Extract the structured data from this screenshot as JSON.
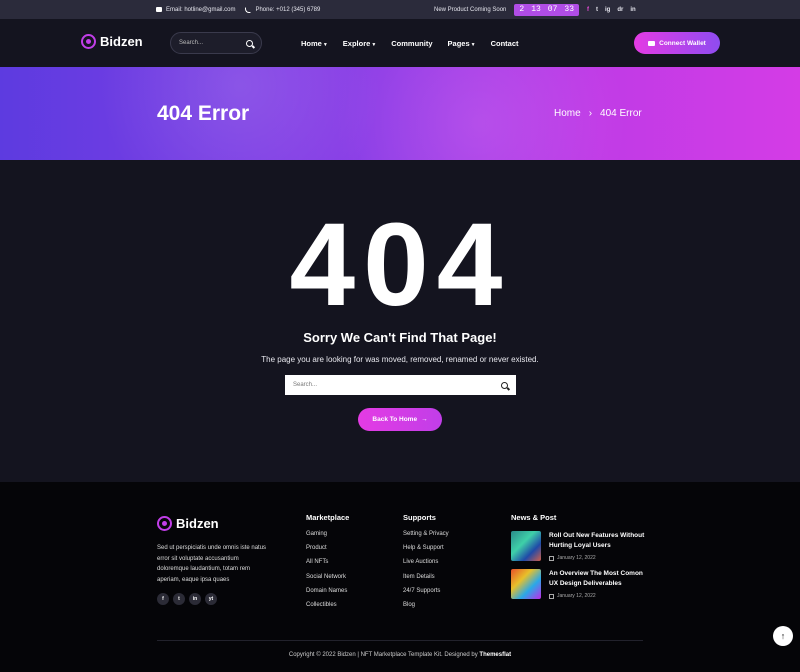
{
  "topbar": {
    "email": "Email: hotline@gmail.com",
    "phone": "Phone: +012 (345) 6789",
    "soon": "New Product Coming Soon",
    "countdown": [
      "2",
      "13",
      "07",
      "33"
    ],
    "socials": [
      "f",
      "t",
      "ig",
      "dr",
      "in"
    ]
  },
  "header": {
    "logo": "Bidzen",
    "search_placeholder": "Search...",
    "nav": [
      {
        "label": "Home",
        "caret": true
      },
      {
        "label": "Explore",
        "caret": true
      },
      {
        "label": "Community",
        "caret": false
      },
      {
        "label": "Pages",
        "caret": true
      },
      {
        "label": "Contact",
        "caret": false
      }
    ],
    "wallet_button": "Connect Wallet"
  },
  "banner": {
    "title": "404 Error",
    "breadcrumb": [
      "Home",
      "›",
      "404 Error"
    ]
  },
  "main": {
    "code": "404",
    "heading": "Sorry We Can't Find That Page!",
    "description": "The page you are looking for was moved, removed, renamed or never existed.",
    "search_placeholder": "Search...",
    "back_button": "Back To Home",
    "back_arrow": "→"
  },
  "footer": {
    "logo": "Bidzen",
    "about": "Sed ut perspiciatis unde omnis iste natus error sit voluptate accusantium doloremque laudantium, totam rem aperiam, eaque ipsa quaes",
    "socials": [
      "f",
      "t",
      "in",
      "yt"
    ],
    "marketplace": {
      "title": "Marketplace",
      "links": [
        "Gaming",
        "Product",
        "All NFTs",
        "Social Network",
        "Domain Names",
        "Collectibles"
      ]
    },
    "supports": {
      "title": "Supports",
      "links": [
        "Setting & Privacy",
        "Help & Support",
        "Live Auctions",
        "Item Details",
        "24/7 Supports",
        "Blog"
      ]
    },
    "news": {
      "title": "News & Post",
      "items": [
        {
          "title": "Roll Out New Features Without Hurting Loyal Users",
          "date": "January 12, 2022"
        },
        {
          "title": "An Overview The Most Comon UX Design Deliverables",
          "date": "January 12, 2022"
        }
      ]
    },
    "copyright_prefix": "Copyright © 2022 Bidzen | NFT Marketplace Template Kit. Designed by ",
    "copyright_brand": "Themesflat",
    "scroll_top": "↑"
  }
}
